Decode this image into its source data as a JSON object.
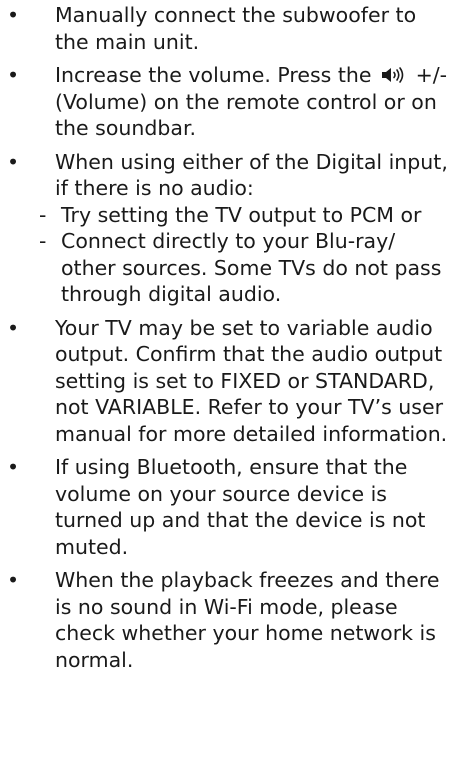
{
  "items": [
    {
      "text": "Manually connect the subwoofer to the main unit."
    },
    {
      "before_icon": "Increase the volume. Press the ",
      "icon": "speaker-volume-icon",
      "after_icon": " +/- (Volume) on the remote control or on the soundbar."
    },
    {
      "text": "When using either of the Digital input, if there is no audio:",
      "sub_items": [
        "Try setting the TV output to PCM or",
        "Connect directly to your Blu-ray/ other sources. Some TVs do not pass through digital audio."
      ]
    },
    {
      "text": "Your TV may be set to variable audio output. Confirm that the audio output setting is set to FIXED or STANDARD,  not VARIABLE. Refer to your TV’s user manual for more detailed information."
    },
    {
      "text": "If using Bluetooth, ensure that the volume on your source device is turned up and that the device is not muted."
    },
    {
      "text": "When the playback freezes and there is no sound in Wi-Fi mode, please check whether your home network is normal."
    }
  ],
  "bullet_char": "•",
  "dash_char": "-"
}
